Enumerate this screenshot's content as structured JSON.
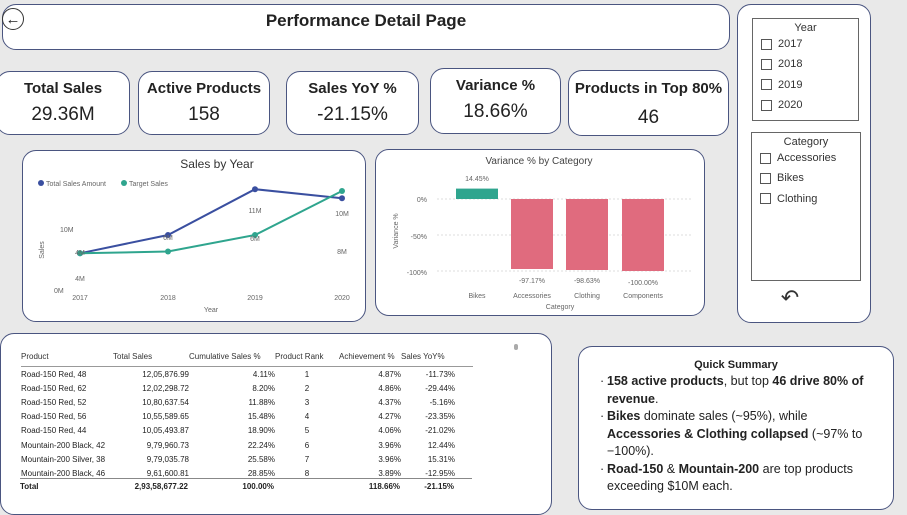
{
  "header": {
    "title": "Performance Detail Page",
    "back_glyph": "←"
  },
  "kpis": {
    "total_sales": {
      "label": "Total Sales",
      "value": "29.36M"
    },
    "active_products": {
      "label": "Active Products",
      "value": "158"
    },
    "sales_yoy": {
      "label": "Sales YoY %",
      "value": "-21.15%"
    },
    "variance": {
      "label": "Variance %",
      "value": "18.66%"
    },
    "top80": {
      "label": "Products in Top 80%",
      "value": "46"
    }
  },
  "sales_chart": {
    "title": "Sales by Year",
    "legend": [
      "Total Sales Amount",
      "Target Sales"
    ],
    "xlabel": "Year",
    "ylabel": "Sales",
    "yticks": [
      "10M",
      "0M"
    ],
    "xticks": [
      "2017",
      "2018",
      "2019",
      "2020"
    ],
    "labels_total": [
      "4M",
      "6M",
      "11M",
      "10M"
    ],
    "labels_target": [
      "4M",
      "",
      "6M",
      "8M"
    ]
  },
  "variance_chart": {
    "title": "Variance % by Category",
    "xlabel": "Category",
    "ylabel": "Variance %",
    "yticks": [
      "0%",
      "-50%",
      "-100%"
    ],
    "categories": [
      "Bikes",
      "Accessories",
      "Clothing",
      "Components"
    ],
    "value_labels": [
      "14.45%",
      "-97.17%",
      "-98.63%",
      "-100.00%"
    ]
  },
  "chart_data": [
    {
      "type": "line",
      "title": "Sales by Year",
      "xlabel": "Year",
      "ylabel": "Sales",
      "x": [
        2017,
        2018,
        2019,
        2020
      ],
      "ylim": [
        0,
        12
      ],
      "series": [
        {
          "name": "Total Sales Amount",
          "values": [
            4,
            6,
            11,
            10
          ],
          "color": "#3a4fa0"
        },
        {
          "name": "Target Sales",
          "values": [
            4,
            4.2,
            6,
            10.8
          ],
          "color": "#2fa58e"
        }
      ],
      "legend": "top-left"
    },
    {
      "type": "bar",
      "title": "Variance % by Category",
      "xlabel": "Category",
      "ylabel": "Variance %",
      "categories": [
        "Bikes",
        "Accessories",
        "Clothing",
        "Components"
      ],
      "values": [
        14.45,
        -97.17,
        -98.63,
        -100.0
      ],
      "colors": [
        "#2fa58e",
        "#e06b7e",
        "#e06b7e",
        "#e06b7e"
      ],
      "ylim": [
        -100,
        14.45
      ]
    }
  ],
  "table": {
    "columns": [
      "Product",
      "Total Sales",
      "Cumulative Sales %",
      "Product Rank",
      "Achievement %",
      "Sales YoY%"
    ],
    "rows": [
      [
        "Road-150 Red, 48",
        "12,05,876.99",
        "4.11%",
        "1",
        "4.87%",
        "-11.73%"
      ],
      [
        "Road-150 Red, 62",
        "12,02,298.72",
        "8.20%",
        "2",
        "4.86%",
        "-29.44%"
      ],
      [
        "Road-150 Red, 52",
        "10,80,637.54",
        "11.88%",
        "3",
        "4.37%",
        "-5.16%"
      ],
      [
        "Road-150 Red, 56",
        "10,55,589.65",
        "15.48%",
        "4",
        "4.27%",
        "-23.35%"
      ],
      [
        "Road-150 Red, 44",
        "10,05,493.87",
        "18.90%",
        "5",
        "4.06%",
        "-21.02%"
      ],
      [
        "Mountain-200 Black, 42",
        "9,79,960.73",
        "22.24%",
        "6",
        "3.96%",
        "12.44%"
      ],
      [
        "Mountain-200 Silver, 38",
        "9,79,035.78",
        "25.58%",
        "7",
        "3.96%",
        "15.31%"
      ],
      [
        "Mountain-200 Black, 46",
        "9,61,600.81",
        "28.85%",
        "8",
        "3.89%",
        "-12.95%"
      ]
    ],
    "total": [
      "Total",
      "2,93,58,677.22",
      "100.00%",
      "",
      "118.66%",
      "-21.15%"
    ]
  },
  "slicers": {
    "year": {
      "title": "Year",
      "items": [
        "2017",
        "2018",
        "2019",
        "2020"
      ]
    },
    "category": {
      "title": "Category",
      "items": [
        "Accessories",
        "Bikes",
        "Clothing"
      ]
    },
    "reset_glyph": "↶"
  },
  "summary": {
    "title": "Quick Summary",
    "b1_bold1": "158 active products",
    "b1_mid": ", but top ",
    "b1_bold2": "46 drive 80% of revenue",
    "b1_end": ".",
    "b2_bold1": "Bikes",
    "b2_mid": " dominate sales (~95%), while ",
    "b2_bold2": "Accessories & Clothing collapsed",
    "b2_end": " (~97% to −100%).",
    "b3_bold1": "Road-150",
    "b3_mid": " & ",
    "b3_bold2": "Mountain-200",
    "b3_end": " are top products exceeding $10M each."
  },
  "colors": {
    "border": "#4a5580",
    "total_line": "#3a4fa0",
    "target_line": "#2fa58e",
    "neg_bar": "#e06b7e",
    "pos_bar": "#2fa58e"
  }
}
